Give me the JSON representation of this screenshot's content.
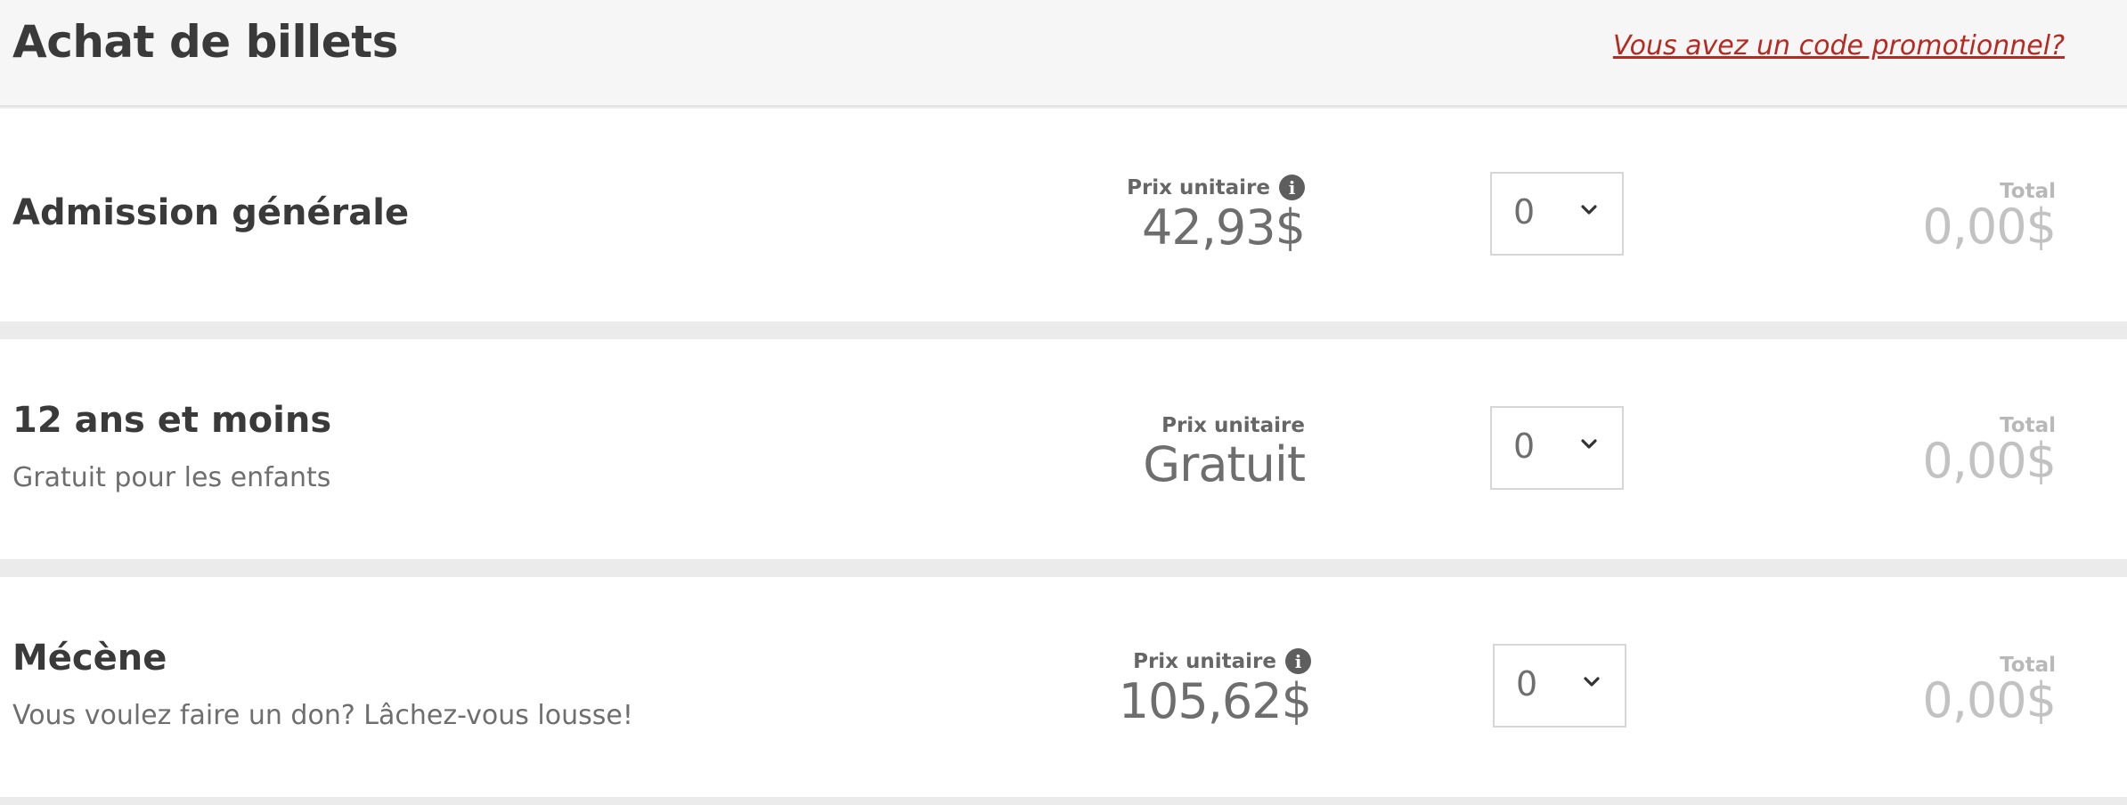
{
  "header": {
    "title": "Achat de billets",
    "promo_link": "Vous avez un code promotionnel?"
  },
  "tickets": [
    {
      "name": "Admission générale",
      "description": "",
      "price_label": "Prix unitaire",
      "price": "42,93$",
      "has_info_icon": true,
      "quantity": "0",
      "total_label": "Total",
      "total": "0,00$"
    },
    {
      "name": "12 ans et moins",
      "description": "Gratuit pour les enfants",
      "price_label": "Prix unitaire",
      "price": "Gratuit",
      "has_info_icon": false,
      "quantity": "0",
      "total_label": "Total",
      "total": "0,00$"
    },
    {
      "name": "Mécène",
      "description": "Vous voulez faire un don? Lâchez-vous lousse!",
      "price_label": "Prix unitaire",
      "price": "105,62$",
      "has_info_icon": true,
      "quantity": "0",
      "total_label": "Total",
      "total": "0,00$"
    }
  ],
  "icons": {
    "info": "info-icon",
    "dropdown": "chevron-down-icon"
  },
  "colors": {
    "promo_link": "#b52a22",
    "header_bg": "#f6f6f6",
    "page_bg": "#ebebeb"
  }
}
